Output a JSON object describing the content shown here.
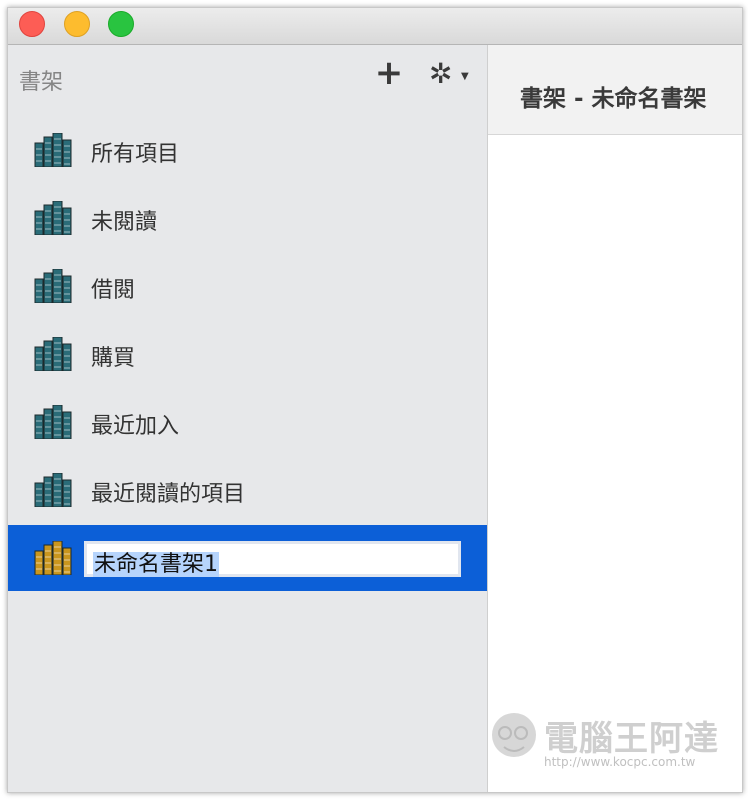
{
  "window": {
    "controls": [
      "close",
      "minimize",
      "zoom"
    ]
  },
  "sidebar": {
    "title": "書架",
    "add_icon": "plus-icon",
    "settings_icon": "gear-icon",
    "items": [
      {
        "label": "所有項目",
        "icon": "bookshelf-icon",
        "color": "#2a6c78"
      },
      {
        "label": "未閱讀",
        "icon": "bookshelf-icon",
        "color": "#2a6c78"
      },
      {
        "label": "借閱",
        "icon": "bookshelf-icon",
        "color": "#2a6c78"
      },
      {
        "label": "購買",
        "icon": "bookshelf-icon",
        "color": "#2a6c78"
      },
      {
        "label": "最近加入",
        "icon": "bookshelf-icon",
        "color": "#2a6c78"
      },
      {
        "label": "最近閱讀的項目",
        "icon": "bookshelf-icon",
        "color": "#2a6c78"
      }
    ],
    "editing_item": {
      "value": "未命名書架1",
      "icon": "bookshelf-icon",
      "color": "#c9961e",
      "selected": true
    }
  },
  "main": {
    "title": "書架 - 未命名書架"
  },
  "watermark": {
    "brand": "電腦王阿達",
    "url": "http://www.kocpc.com.tw"
  },
  "colors": {
    "selection": "#0c5fd7",
    "sidebar_bg": "#e7e8ea"
  }
}
